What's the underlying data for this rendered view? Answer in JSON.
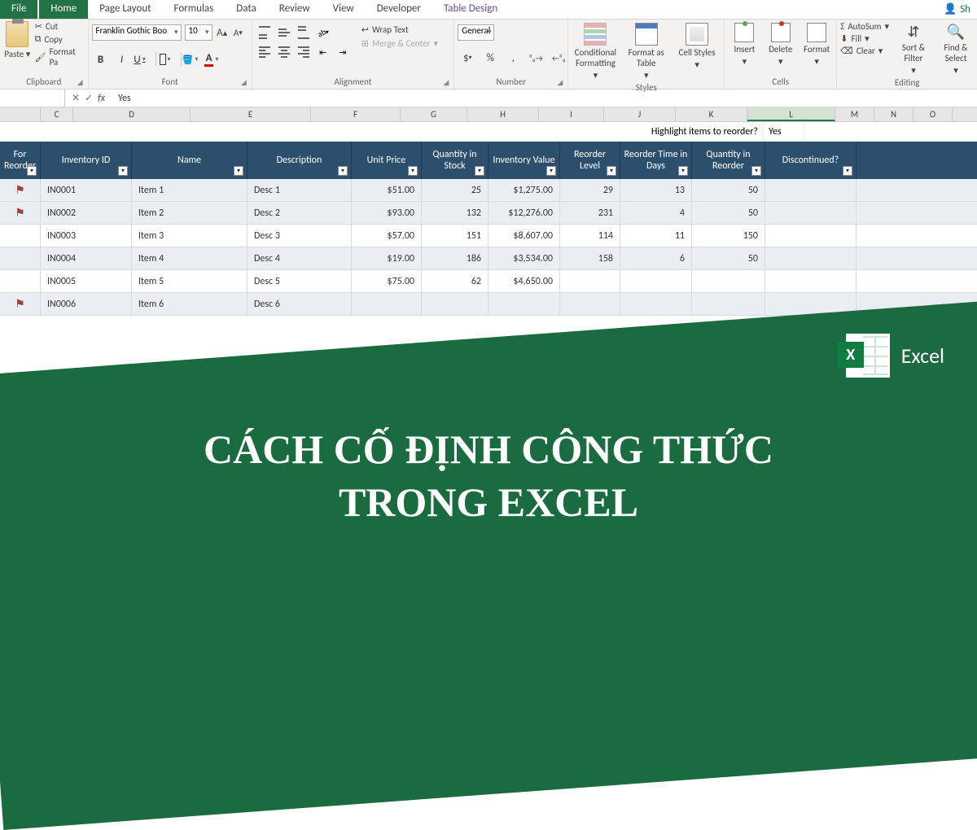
{
  "tabs": {
    "file": "File",
    "home": "Home",
    "page_layout": "Page Layout",
    "formulas": "Formulas",
    "data": "Data",
    "review": "Review",
    "view": "View",
    "developer": "Developer",
    "table_design": "Table Design",
    "share": "Sh"
  },
  "ribbon": {
    "clipboard": {
      "label": "Clipboard",
      "paste": "Paste",
      "cut": "Cut",
      "copy": "Copy",
      "format_painter": "Format Pa"
    },
    "font": {
      "label": "Font",
      "name": "Franklin Gothic Boo",
      "size": "10",
      "inc": "A",
      "dec": "A",
      "bold": "B",
      "italic": "I",
      "underline": "U",
      "fontcolor_glyph": "A"
    },
    "alignment": {
      "label": "Alignment",
      "wrap": "Wrap Text",
      "merge": "Merge & Center"
    },
    "number": {
      "label": "Number",
      "format": "General",
      "currency": "$",
      "percent": "%",
      "comma": ",",
      "inc_dec": ".0",
      "dec_dec": ".00"
    },
    "styles": {
      "label": "Styles",
      "cf": "Conditional Formatting",
      "fat": "Format as Table",
      "cs": "Cell Styles"
    },
    "cells": {
      "label": "Cells",
      "insert": "Insert",
      "delete": "Delete",
      "format": "Format"
    },
    "editing": {
      "label": "Editing",
      "autosum": "AutoSum",
      "fill": "Fill",
      "clear": "Clear",
      "sort": "Sort & Filter",
      "find": "Find & Select"
    }
  },
  "formula_bar": {
    "cancel": "✕",
    "enter": "✓",
    "fx": "fx",
    "value": "Yes"
  },
  "columns": [
    "",
    "C",
    "D",
    "E",
    "F",
    "G",
    "H",
    "I",
    "J",
    "K",
    "L",
    "M",
    "N",
    "O"
  ],
  "highlight": {
    "label": "Highlight items to reorder?",
    "value": "Yes"
  },
  "headers": {
    "flag": "For Reorder",
    "id": "Inventory ID",
    "name": "Name",
    "desc": "Description",
    "price": "Unit Price",
    "qty": "Quantity in Stock",
    "val": "Inventory Value",
    "rl": "Reorder Level",
    "rt": "Reorder Time in Days",
    "qr": "Quantity in Reorder",
    "disc": "Discontinued?"
  },
  "rows": [
    {
      "flag": "⚑",
      "id": "IN0001",
      "name": "Item 1",
      "desc": "Desc 1",
      "price": "$51.00",
      "qty": "25",
      "val": "$1,275.00",
      "rl": "29",
      "rt": "13",
      "qr": "50",
      "disc": "",
      "band": true
    },
    {
      "flag": "⚑",
      "id": "IN0002",
      "name": "Item 2",
      "desc": "Desc 2",
      "price": "$93.00",
      "qty": "132",
      "val": "$12,276.00",
      "rl": "231",
      "rt": "4",
      "qr": "50",
      "disc": "",
      "band": true
    },
    {
      "flag": "",
      "id": "IN0003",
      "name": "Item 3",
      "desc": "Desc 3",
      "price": "$57.00",
      "qty": "151",
      "val": "$8,607.00",
      "rl": "114",
      "rt": "11",
      "qr": "150",
      "disc": "",
      "band": false
    },
    {
      "flag": "",
      "id": "IN0004",
      "name": "Item 4",
      "desc": "Desc 4",
      "price": "$19.00",
      "qty": "186",
      "val": "$3,534.00",
      "rl": "158",
      "rt": "6",
      "qr": "50",
      "disc": "",
      "band": true
    },
    {
      "flag": "",
      "id": "IN0005",
      "name": "Item 5",
      "desc": "Desc 5",
      "price": "$75.00",
      "qty": "62",
      "val": "$4,650.00",
      "rl": "",
      "rt": "",
      "qr": "",
      "disc": "",
      "band": false
    },
    {
      "flag": "⚑",
      "id": "IN0006",
      "name": "Item 6",
      "desc": "Desc 6",
      "price": "",
      "qty": "",
      "val": "",
      "rl": "",
      "rt": "",
      "qr": "",
      "disc": "",
      "band": true
    }
  ],
  "overlay": {
    "title_line1": "CÁCH CỐ ĐỊNH CÔNG THỨC",
    "title_line2": "TRONG EXCEL",
    "badge": "Excel",
    "x": "X"
  }
}
